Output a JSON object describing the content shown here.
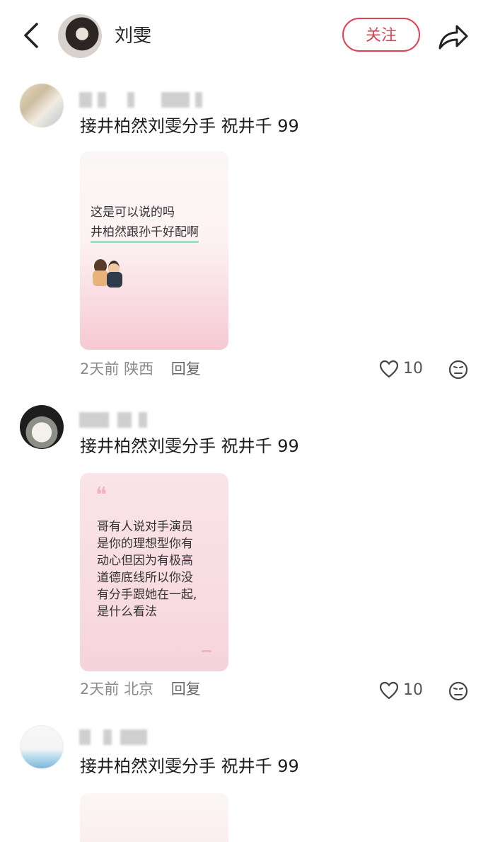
{
  "header": {
    "title": "刘雯",
    "follow_label": "关注",
    "back_icon": "chevron-left-icon",
    "share_icon": "share-icon"
  },
  "comments": [
    {
      "text": "接井柏然刘雯分手 祝井千 99",
      "card": {
        "line1": "这是可以说的吗",
        "line2": "井柏然跟孙千好配啊"
      },
      "time": "2天前",
      "location": "陕西",
      "reply_label": "回复",
      "likes": "10"
    },
    {
      "text": "接井柏然刘雯分手 祝井千 99",
      "card": {
        "quote_mark": "❝",
        "lines": [
          "哥有人说对手演员",
          "是你的理想型你有",
          "动心但因为有极高",
          "道德底线所以你没",
          "有分手跟她在一起,",
          "是什么看法"
        ]
      },
      "time": "2天前",
      "location": "北京",
      "reply_label": "回复",
      "likes": "10"
    },
    {
      "text": "接井柏然刘雯分手 祝井千 99"
    }
  ],
  "colors": {
    "accent": "#e04155",
    "meta": "#8b8b8b",
    "card_pink": "#f8d9df"
  }
}
